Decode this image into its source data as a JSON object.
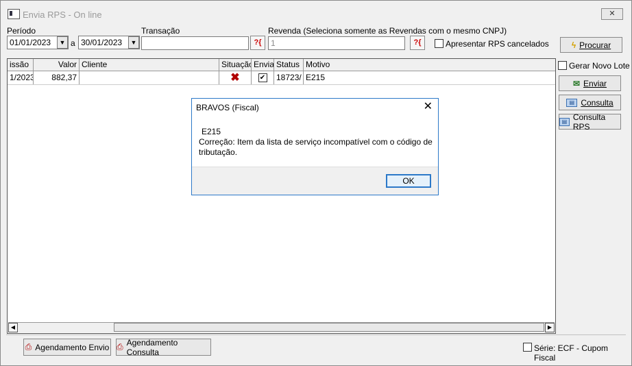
{
  "window": {
    "title": "Envia RPS - On line",
    "close_label": "✕"
  },
  "filters": {
    "periodo_label": "Período",
    "date_from": "01/01/2023",
    "date_sep": "a",
    "date_to": "30/01/2023",
    "transacao_label": "Transação",
    "transacao_value": "",
    "revenda_label": "Revenda (Seleciona somente as Revendas com o mesmo CNPJ)",
    "revenda_value": "1",
    "apresentar_label": "Apresentar RPS cancelados",
    "help_label": "?{"
  },
  "buttons": {
    "procurar": "Procurar",
    "gerar_novo_lote": "Gerar Novo Lote",
    "enviar": "Enviar",
    "consulta": "Consulta",
    "consulta_rps": "Consulta RPS",
    "agendamento_envio": "Agendamento Envio",
    "agendamento_consulta": "Agendamento Consulta"
  },
  "table": {
    "headers": {
      "emissao": "issão",
      "valor": "Valor",
      "cliente": "Cliente",
      "situacao": "Situação",
      "enviar": "Enviar",
      "status": "Status",
      "motivo": "Motivo"
    },
    "rows": [
      {
        "emissao": "1/2023",
        "valor": "882,37",
        "cliente": "",
        "situacao_icon": "✖",
        "enviar": "✔",
        "status": "18723/",
        "motivo": "E215"
      }
    ]
  },
  "footer": {
    "serie_label": "Série: ECF - Cupom Fiscal"
  },
  "dialog": {
    "title": "BRAVOS (Fiscal)",
    "code": "E215",
    "message": "Correção: Item da lista de serviço incompatível com o código de tributação.",
    "ok_label": "OK",
    "close_label": "✕"
  },
  "colors": {
    "accent": "#2b78c8",
    "error": "#c00000"
  }
}
